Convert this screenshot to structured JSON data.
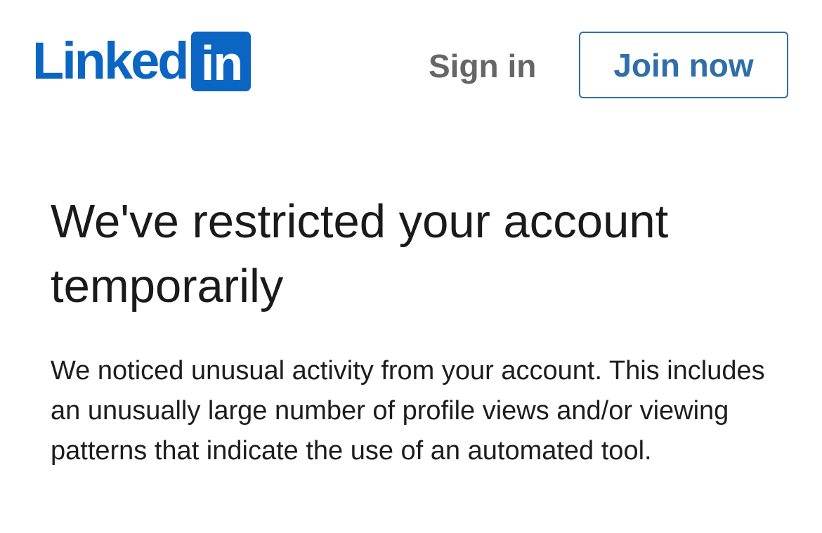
{
  "header": {
    "logo": {
      "word": "Linked",
      "box_text": "in",
      "brand_color": "#0a66c2"
    },
    "sign_in_label": "Sign in",
    "join_now_label": "Join now"
  },
  "main": {
    "title": "We've restricted your account temporarily",
    "body": "We noticed unusual activity from your account. This includes an unusually large number of profile views and/or viewing patterns that indicate the use of an automated tool."
  }
}
